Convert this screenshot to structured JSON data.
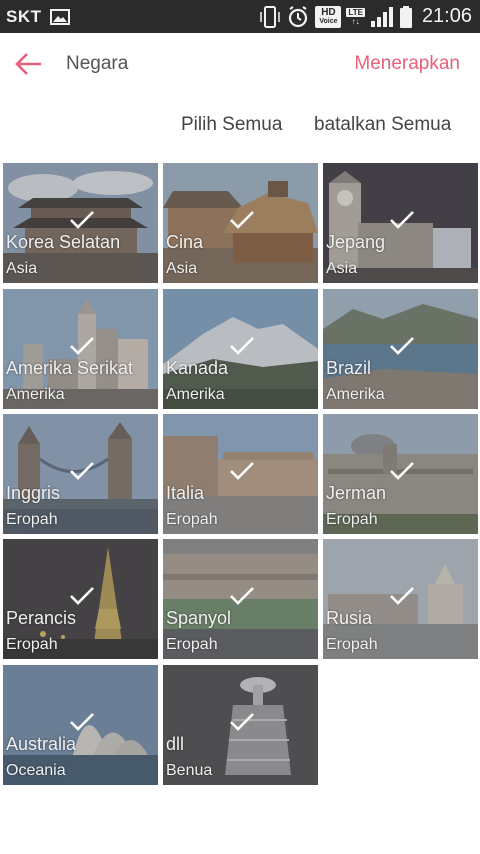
{
  "status_bar": {
    "carrier": "SKT",
    "time": "21:06",
    "hd_label": "HD",
    "voice_label": "Voice",
    "lte_label": "LTE",
    "icons": [
      "gallery-icon",
      "vibrate-icon",
      "alarm-icon",
      "hd-voice-icon",
      "lte-icon",
      "signal-icon",
      "battery-icon"
    ]
  },
  "header": {
    "title": "Negara",
    "apply_label": "Menerapkan",
    "back_icon": "back-arrow-icon",
    "accent": "#e8607a"
  },
  "selection": {
    "select_all": "Pilih Semua",
    "deselect_all": "batalkan Semua"
  },
  "countries": [
    {
      "name": "Korea Selatan",
      "region": "Asia",
      "checked": true
    },
    {
      "name": "Cina",
      "region": "Asia",
      "checked": true
    },
    {
      "name": "Jepang",
      "region": "Asia",
      "checked": true
    },
    {
      "name": "Amerika Serikat",
      "region": "Amerika",
      "checked": true
    },
    {
      "name": "Kanada",
      "region": "Amerika",
      "checked": true
    },
    {
      "name": "Brazil",
      "region": "Amerika",
      "checked": true
    },
    {
      "name": "Inggris",
      "region": "Eropah",
      "checked": true
    },
    {
      "name": "Italia",
      "region": "Eropah",
      "checked": true
    },
    {
      "name": "Jerman",
      "region": "Eropah",
      "checked": true
    },
    {
      "name": "Perancis",
      "region": "Eropah",
      "checked": true
    },
    {
      "name": "Spanyol",
      "region": "Eropah",
      "checked": true
    },
    {
      "name": "Rusia",
      "region": "Eropah",
      "checked": true
    },
    {
      "name": "Australia",
      "region": "Oceania",
      "checked": true
    },
    {
      "name": "dll",
      "region": "Benua",
      "checked": true
    }
  ]
}
